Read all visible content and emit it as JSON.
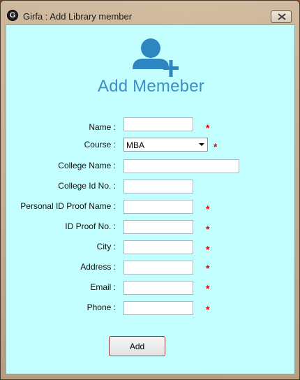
{
  "window": {
    "title": "Girfa : Add Library member",
    "app_icon_letter": "G"
  },
  "heading": "Add Memeber",
  "colors": {
    "client_background": "#c4ffff",
    "heading": "#3d8fc4",
    "icon": "#2d86c0",
    "required_marker": "#e00000"
  },
  "form": {
    "required_marker": "*",
    "fields": {
      "name": {
        "label": "Name :",
        "value": "",
        "required": true
      },
      "course": {
        "label": "Course :",
        "value": "MBA",
        "required": true
      },
      "college_name": {
        "label": "College Name :",
        "value": "",
        "required": false
      },
      "college_id": {
        "label": "College Id No. :",
        "value": "",
        "required": false
      },
      "id_proof_name": {
        "label": "Personal ID Proof Name :",
        "value": "",
        "required": true
      },
      "id_proof_no": {
        "label": "ID Proof No. :",
        "value": "",
        "required": true
      },
      "city": {
        "label": "City :",
        "value": "",
        "required": true
      },
      "address": {
        "label": "Address :",
        "value": "",
        "required": true
      },
      "email": {
        "label": "Email :",
        "value": "",
        "required": true
      },
      "phone": {
        "label": "Phone :",
        "value": "",
        "required": true
      }
    },
    "add_button_label": "Add"
  }
}
